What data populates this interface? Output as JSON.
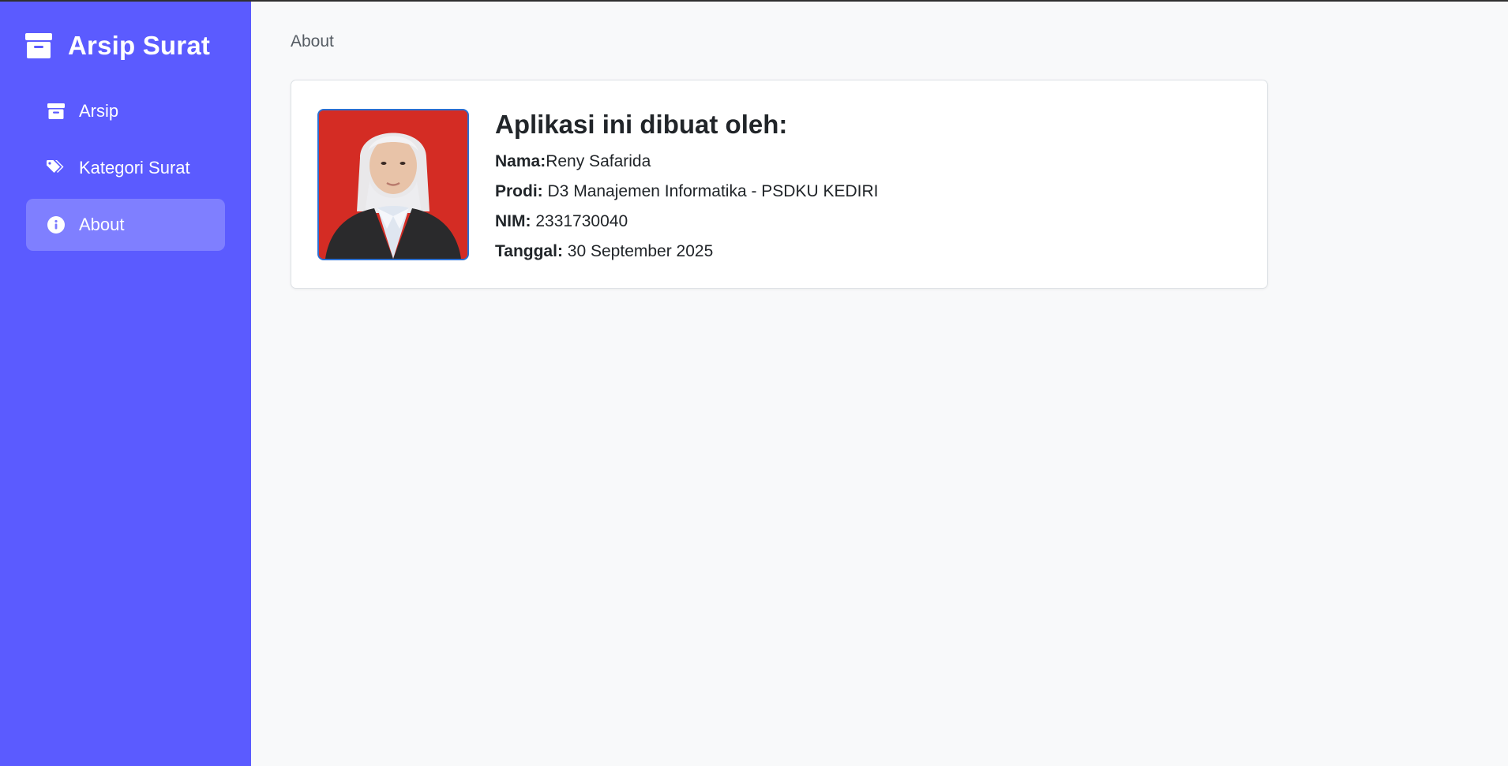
{
  "sidebar": {
    "brand": {
      "title": "Arsip Surat",
      "icon": "archive-box-icon"
    },
    "items": [
      {
        "label": "Arsip",
        "icon": "archive-icon",
        "active": false
      },
      {
        "label": "Kategori Surat",
        "icon": "tags-icon",
        "active": false
      },
      {
        "label": "About",
        "icon": "info-circle-icon",
        "active": true
      }
    ]
  },
  "main": {
    "breadcrumb": "About",
    "about": {
      "heading": "Aplikasi ini dibuat oleh:",
      "fields": [
        {
          "label": "Nama:",
          "value": "Reny Safarida"
        },
        {
          "label": "Prodi:",
          "value": "D3 Manajemen Informatika - PSDKU KEDIRI"
        },
        {
          "label": "NIM:",
          "value": "2331730040"
        },
        {
          "label": "Tanggal:",
          "value": "30 September 2025"
        }
      ]
    }
  },
  "colors": {
    "sidebar_bg": "#5b5bff",
    "page_bg": "#f8f9fa",
    "photo_bg": "#d42c24",
    "photo_border": "#2b6fd1"
  }
}
